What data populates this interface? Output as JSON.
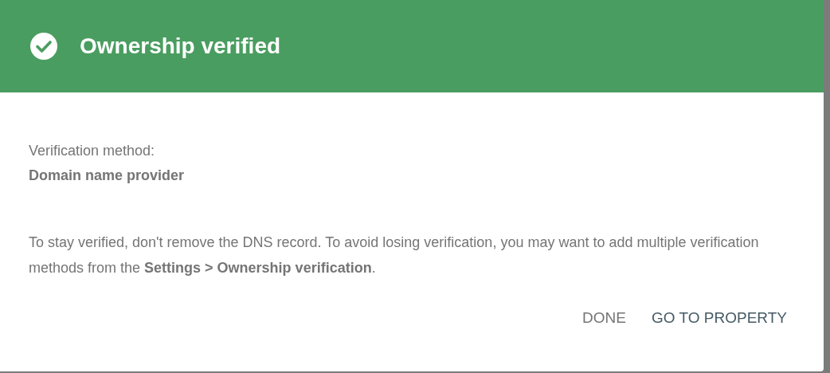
{
  "dialog": {
    "title": "Ownership verified",
    "method_label": "Verification method:",
    "method_value": "Domain name provider",
    "message": "To stay verified, don't remove the DNS record. To avoid losing verification, you may want to add multiple verification methods from the **Settings > Ownership verification**.",
    "buttons": [
      {
        "label": "DONE",
        "kind": "secondary"
      },
      {
        "label": "GO TO PROPERTY",
        "kind": "primary"
      }
    ]
  }
}
